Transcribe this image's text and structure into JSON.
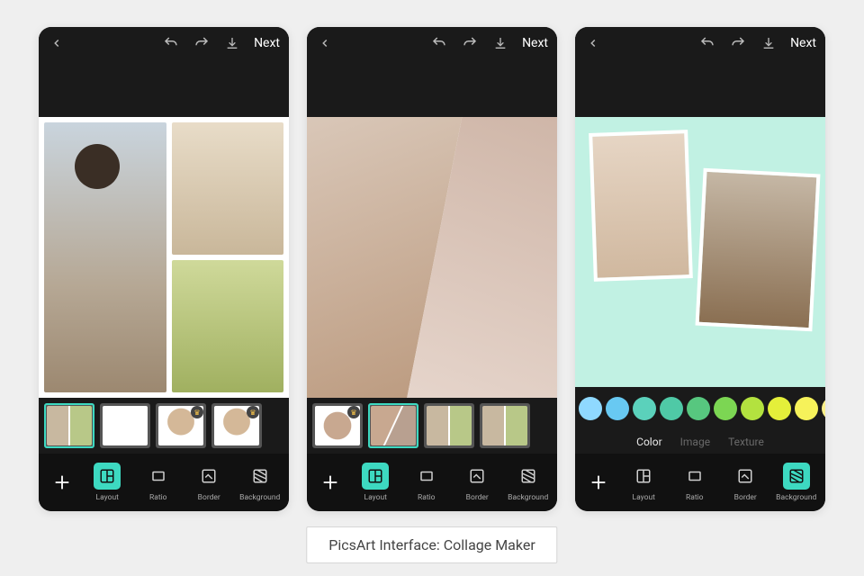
{
  "caption": "PicsArt Interface: Collage Maker",
  "header": {
    "next": "Next"
  },
  "toolbar": {
    "layout": "Layout",
    "ratio": "Ratio",
    "border": "Border",
    "background": "Background"
  },
  "background_tabs": {
    "color": "Color",
    "image": "Image",
    "texture": "Texture"
  },
  "phones": [
    {
      "active_tool": "layout",
      "layout_thumbs": [
        {
          "kind": "grid",
          "selected": true,
          "premium": false
        },
        {
          "kind": "blank",
          "selected": false,
          "premium": false
        },
        {
          "kind": "heart",
          "selected": false,
          "premium": true
        },
        {
          "kind": "heart",
          "selected": false,
          "premium": true
        }
      ]
    },
    {
      "active_tool": "layout",
      "layout_thumbs": [
        {
          "kind": "circle",
          "selected": false,
          "premium": true
        },
        {
          "kind": "diag",
          "selected": true,
          "premium": false
        },
        {
          "kind": "grid",
          "selected": false,
          "premium": false
        },
        {
          "kind": "grid",
          "selected": false,
          "premium": false
        }
      ]
    },
    {
      "active_tool": "background",
      "background_active_tab": "color",
      "color_swatches": [
        "#8fd9ff",
        "#68c9f2",
        "#5bd1bb",
        "#4fc9a6",
        "#57c77f",
        "#7cd653",
        "#b3e23f",
        "#e4ef3a",
        "#f6f25a",
        "#fbf08a"
      ]
    }
  ]
}
